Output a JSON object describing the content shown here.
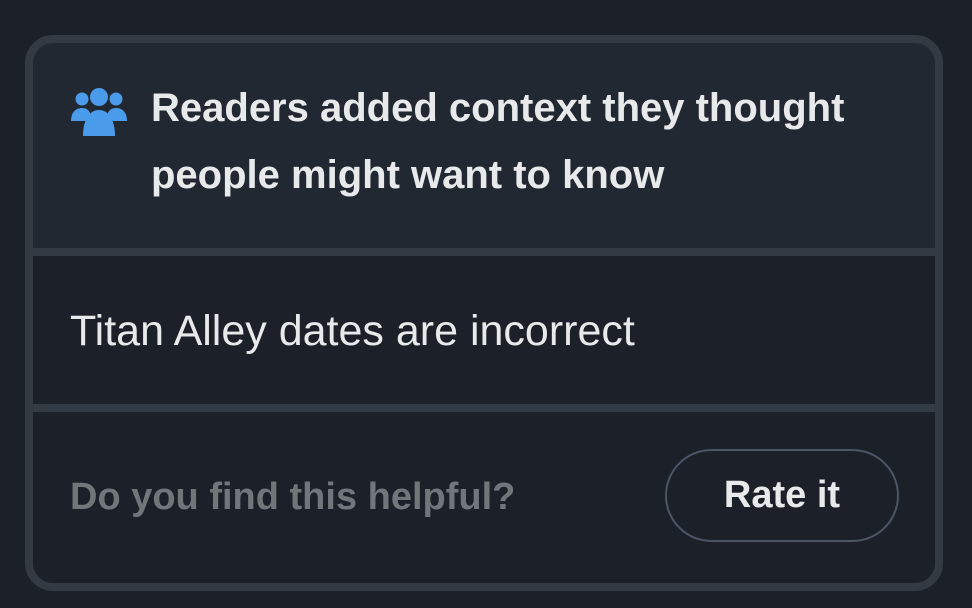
{
  "note": {
    "header_title": "Readers added context they thought people might want to know",
    "header_icon": "people-group-icon",
    "body_text": "Titan Alley dates are incorrect",
    "helpful_prompt": "Do you find this helpful?",
    "rate_button_label": "Rate it"
  },
  "colors": {
    "page_background": "#1b2029",
    "card_border": "#343a44",
    "header_background": "#222831",
    "icon_accent": "#1d9bf0",
    "primary_text": "#e7e9ea",
    "secondary_text": "#71767b"
  }
}
